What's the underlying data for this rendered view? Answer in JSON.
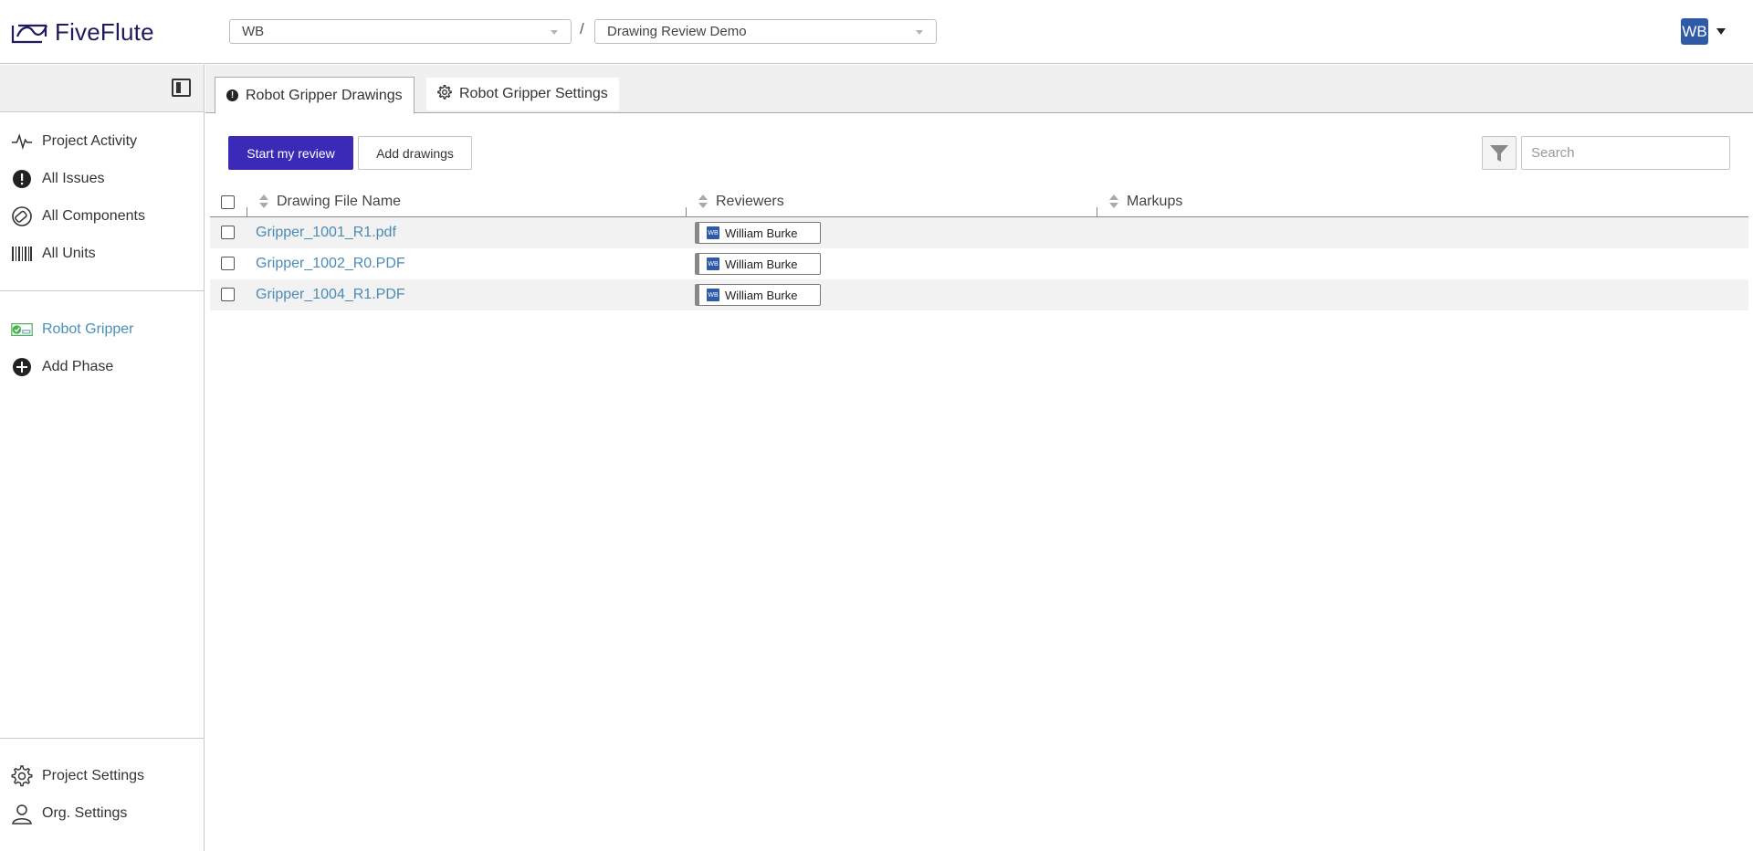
{
  "header": {
    "logo_text_a": "Five",
    "logo_text_b": "Flute",
    "org_select": "WB",
    "separator": "/",
    "project_select": "Drawing Review Demo",
    "user_initials": "WB"
  },
  "sidebar": {
    "items": [
      {
        "label": "Project Activity",
        "icon": "activity-icon"
      },
      {
        "label": "All Issues",
        "icon": "alert-icon"
      },
      {
        "label": "All Components",
        "icon": "components-icon"
      },
      {
        "label": "All Units",
        "icon": "barcode-icon"
      }
    ],
    "phases": [
      {
        "label": "Robot Gripper",
        "icon": "phase-icon",
        "active": true
      },
      {
        "label": "Add Phase",
        "icon": "plus-circle-icon"
      }
    ],
    "bottom": [
      {
        "label": "Project Settings",
        "icon": "gear-icon"
      },
      {
        "label": "Org. Settings",
        "icon": "user-icon"
      }
    ]
  },
  "tabs": [
    {
      "label": "Robot Gripper Drawings",
      "active": true
    },
    {
      "label": "Robot Gripper Settings",
      "active": false
    }
  ],
  "toolbar": {
    "start_review": "Start my review",
    "add_drawings": "Add drawings",
    "search_placeholder": "Search"
  },
  "table": {
    "columns": [
      "Drawing File Name",
      "Reviewers",
      "Markups"
    ],
    "rows": [
      {
        "file": "Gripper_1001_R1.pdf",
        "reviewer": "William Burke",
        "reviewer_initials": "WB",
        "markups": ""
      },
      {
        "file": "Gripper_1002_R0.PDF",
        "reviewer": "William Burke",
        "reviewer_initials": "WB",
        "markups": ""
      },
      {
        "file": "Gripper_1004_R1.PDF",
        "reviewer": "William Burke",
        "reviewer_initials": "WB",
        "markups": ""
      }
    ]
  },
  "colors": {
    "brand": "#1e1b5e",
    "primary_button": "#3a2ab7",
    "link": "#4a8cb5",
    "avatar": "#2f5aa8"
  }
}
